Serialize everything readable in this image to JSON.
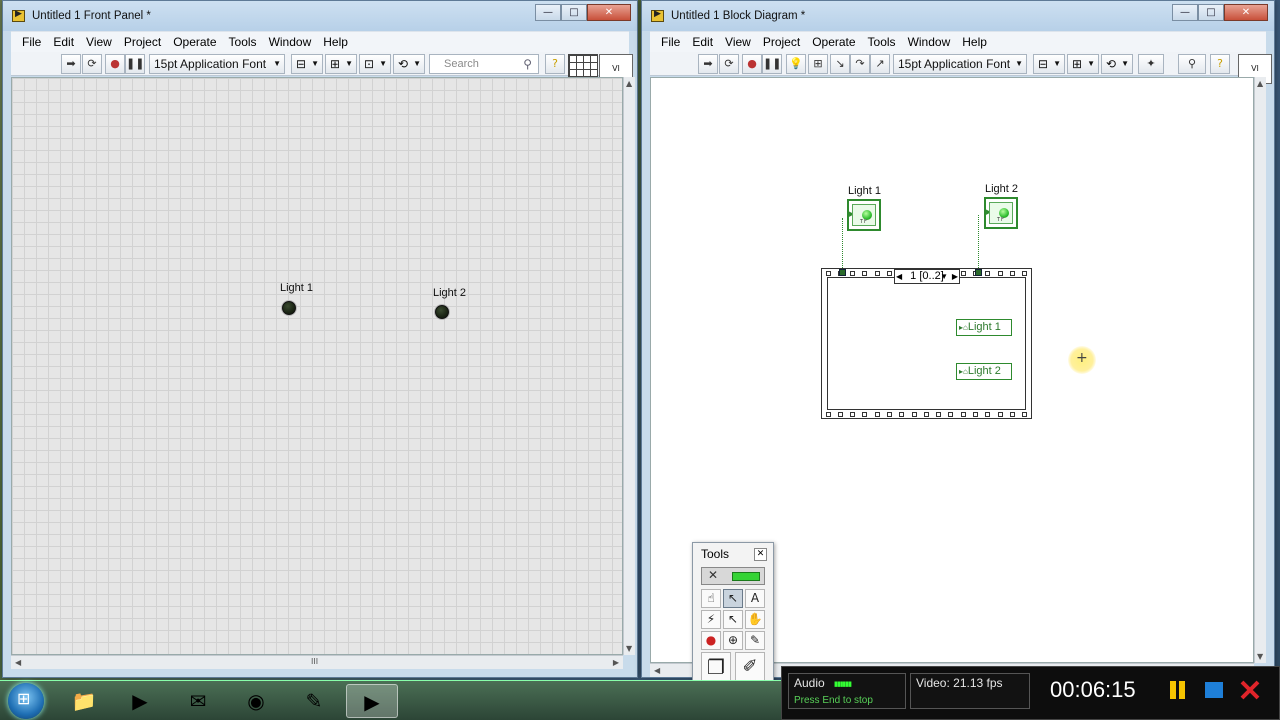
{
  "front_panel": {
    "title": "Untitled 1 Front Panel *",
    "menu": [
      "File",
      "Edit",
      "View",
      "Project",
      "Operate",
      "Tools",
      "Window",
      "Help"
    ],
    "font_select": "15pt Application Font",
    "search_placeholder": "Search",
    "indicators": [
      {
        "label": "Light 1",
        "state": "off"
      },
      {
        "label": "Light 2",
        "state": "off"
      }
    ],
    "hscroll_grip": "III"
  },
  "block_diagram": {
    "title": "Untitled 1 Block Diagram *",
    "menu": [
      "File",
      "Edit",
      "View",
      "Project",
      "Operate",
      "Tools",
      "Window",
      "Help"
    ],
    "font_select": "15pt Application Font",
    "terminals": [
      {
        "label": "Light 1"
      },
      {
        "label": "Light 2"
      }
    ],
    "sequence_selector": "1 [0..2]",
    "local_variables": [
      "Light 1",
      "Light 2"
    ]
  },
  "tools_palette": {
    "title": "Tools"
  },
  "recorder": {
    "audio_label": "Audio",
    "video_label": "Video: 21.13 fps",
    "hint": "Press End to stop",
    "elapsed": "00:06:15"
  },
  "colors": {
    "terminal_green": "#2e8a2e",
    "led_on": "#2fbd2f",
    "led_off": "#1a2414",
    "recorder_pause": "#f5c400",
    "recorder_stop": "#1e7fd8",
    "recorder_close": "#e0242a"
  },
  "icons": {
    "run": "run-arrow-icon",
    "run_continuous": "run-continuously-icon",
    "abort": "abort-icon",
    "pause": "pause-icon",
    "highlight": "highlight-execution-icon",
    "search": "magnifier-icon",
    "help": "help-icon"
  }
}
